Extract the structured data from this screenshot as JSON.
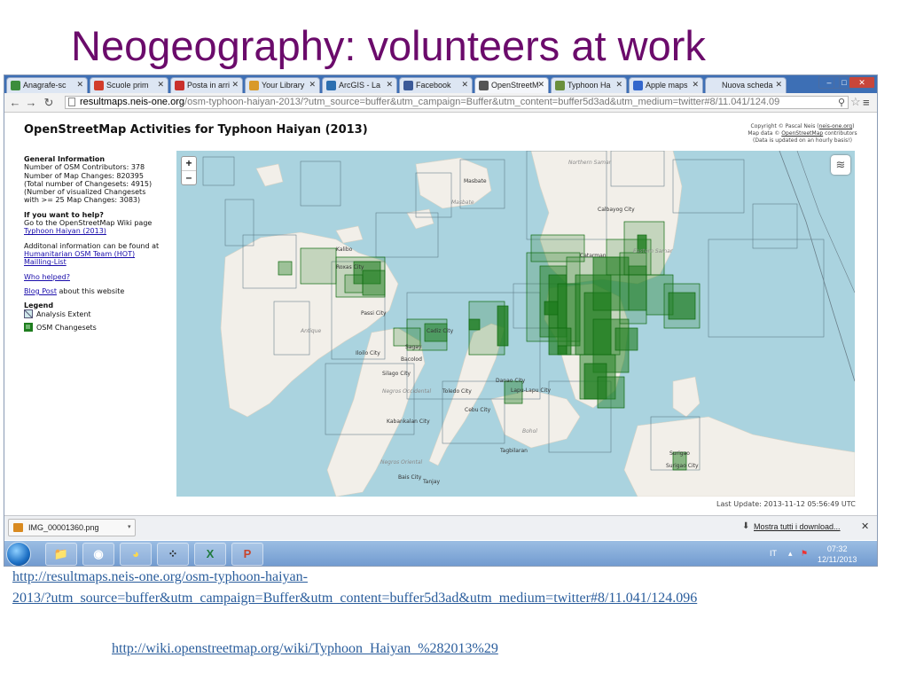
{
  "slide": {
    "title": "Neogeography: volunteers at work",
    "link1_line1": "http://resultmaps.neis-one.org/osm-typhoon-haiyan-",
    "link1_line2": "2013/?utm_source=buffer&utm_campaign=Buffer&utm_content=buffer5d3ad&utm_medium=twitter#8/11.041/124.096",
    "link2": "http://wiki.openstreetmap.org/wiki/Typhoon_Haiyan_%282013%29"
  },
  "browser": {
    "tabs": [
      {
        "label": "Anagrafe-sc",
        "icon": "chart-icon",
        "color": "#3c8d3c"
      },
      {
        "label": "Scuole prim",
        "icon": "map-pin-icon",
        "color": "#d23c2a"
      },
      {
        "label": "Posta in arri",
        "icon": "gmail-icon",
        "color": "#c9302c"
      },
      {
        "label": "Your Library",
        "icon": "library-icon",
        "color": "#d99a2a"
      },
      {
        "label": "ArcGIS - La",
        "icon": "globe-icon",
        "color": "#2c6fb0"
      },
      {
        "label": "Facebook",
        "icon": "facebook-icon",
        "color": "#3b5998"
      },
      {
        "label": "OpenStreetM",
        "icon": "osm-icon",
        "color": "#555555"
      },
      {
        "label": "Typhoon Ha",
        "icon": "pencil-icon",
        "color": "#6a8f3c"
      },
      {
        "label": "Apple maps",
        "icon": "google-icon",
        "color": "#3366cc"
      },
      {
        "label": "Nuova scheda",
        "icon": "",
        "color": ""
      }
    ],
    "url_host": "resultmaps.neis-one.org",
    "url_path": "/osm-typhoon-haiyan-2013/?utm_source=buffer&utm_campaign=Buffer&utm_content=buffer5d3ad&utm_medium=twitter#8/11.041/124.09",
    "window_controls": [
      "–",
      "□",
      "✕"
    ]
  },
  "page": {
    "title": "OpenStreetMap Activities for Typhoon Haiyan (2013)",
    "copyright_line1": "Copyright © Pascal Neis",
    "copyright_link1": "neis-one.org",
    "copyright_line2": "Map data ©",
    "copyright_link2": "OpenStreetMap",
    "copyright_line2b": "contributors",
    "copyright_line3": "(Data is updated on an hourly basis!)",
    "general_heading": "General Information",
    "general_lines": [
      "Number of OSM Contributors: 378",
      "Number of Map Changes: 820395",
      "(Total number of Changesets: 4915)",
      "(Number of visualized Changesets",
      "with >= 25 Map Changes: 3083)"
    ],
    "help_heading": "If you want to help?",
    "help_text": "Go to the OpenStreetMap Wiki page",
    "help_link": "Typhoon Haiyan (2013)",
    "additional_text": "Additonal information can be found at",
    "hot_link": "Humanitarian OSM Team (HOT)",
    "list_link": "Mailling-List",
    "who_link": "Who helped?",
    "blog_link": "Blog Post",
    "blog_text": " about this website",
    "legend_heading": "Legend",
    "legend_items": [
      "Analysis Extent",
      "OSM Changesets"
    ],
    "zoom_in": "+",
    "zoom_out": "–",
    "last_update": "Last Update: 2013-11-12 05:56:49 UTC",
    "map_labels": [
      {
        "text": "Northern Samar",
        "cls": "region"
      },
      {
        "text": "Calbayog City",
        "cls": "city"
      },
      {
        "text": "Masbate",
        "cls": "city"
      },
      {
        "text": "Masbate",
        "cls": "region"
      },
      {
        "text": "Catarman",
        "cls": "city"
      },
      {
        "text": "Eastern Samar",
        "cls": "region"
      },
      {
        "text": "Kalibo",
        "cls": "city"
      },
      {
        "text": "Roxas City",
        "cls": "city"
      },
      {
        "text": "Passi City",
        "cls": "city"
      },
      {
        "text": "Antique",
        "cls": "region"
      },
      {
        "text": "Sagay",
        "cls": "city"
      },
      {
        "text": "Bacolod",
        "cls": "city"
      },
      {
        "text": "Iloilo City",
        "cls": "city"
      },
      {
        "text": "Cadiz City",
        "cls": "city"
      },
      {
        "text": "Silago City",
        "cls": "city"
      },
      {
        "text": "Negros Occidental",
        "cls": "region"
      },
      {
        "text": "Toledo City",
        "cls": "city"
      },
      {
        "text": "Danao City",
        "cls": "city"
      },
      {
        "text": "Lapu-Lapu City",
        "cls": "city"
      },
      {
        "text": "Cebu City",
        "cls": "city"
      },
      {
        "text": "Kabankalan City",
        "cls": "city"
      },
      {
        "text": "Bohol",
        "cls": "region"
      },
      {
        "text": "Tagbilaran",
        "cls": "city"
      },
      {
        "text": "Negros Oriental",
        "cls": "region"
      },
      {
        "text": "Bais City",
        "cls": "city"
      },
      {
        "text": "Tanjay",
        "cls": "city"
      },
      {
        "text": "Surigao",
        "cls": "city"
      },
      {
        "text": "Surigao City",
        "cls": "city"
      }
    ]
  },
  "downloads": {
    "file": "IMG_00001360.png",
    "show_all": "Mostra tutti i download...",
    "close": "✕"
  },
  "taskbar": {
    "apps": [
      {
        "name": "explorer-icon",
        "glyph": "📁"
      },
      {
        "name": "chrome-icon",
        "glyph": "◉"
      },
      {
        "name": "media-player-icon",
        "glyph": "◕"
      },
      {
        "name": "blackberry-icon",
        "glyph": "⁘"
      },
      {
        "name": "excel-icon",
        "glyph": "X"
      },
      {
        "name": "powerpoint-icon",
        "glyph": "P"
      }
    ],
    "lang": "IT",
    "time": "07:32",
    "date": "12/11/2013"
  },
  "colors": {
    "title": "#6b0b6b",
    "link": "#2a5d9c",
    "sea": "#aad3df",
    "land": "#f2efe9",
    "changeset": "#1e7d1e"
  }
}
